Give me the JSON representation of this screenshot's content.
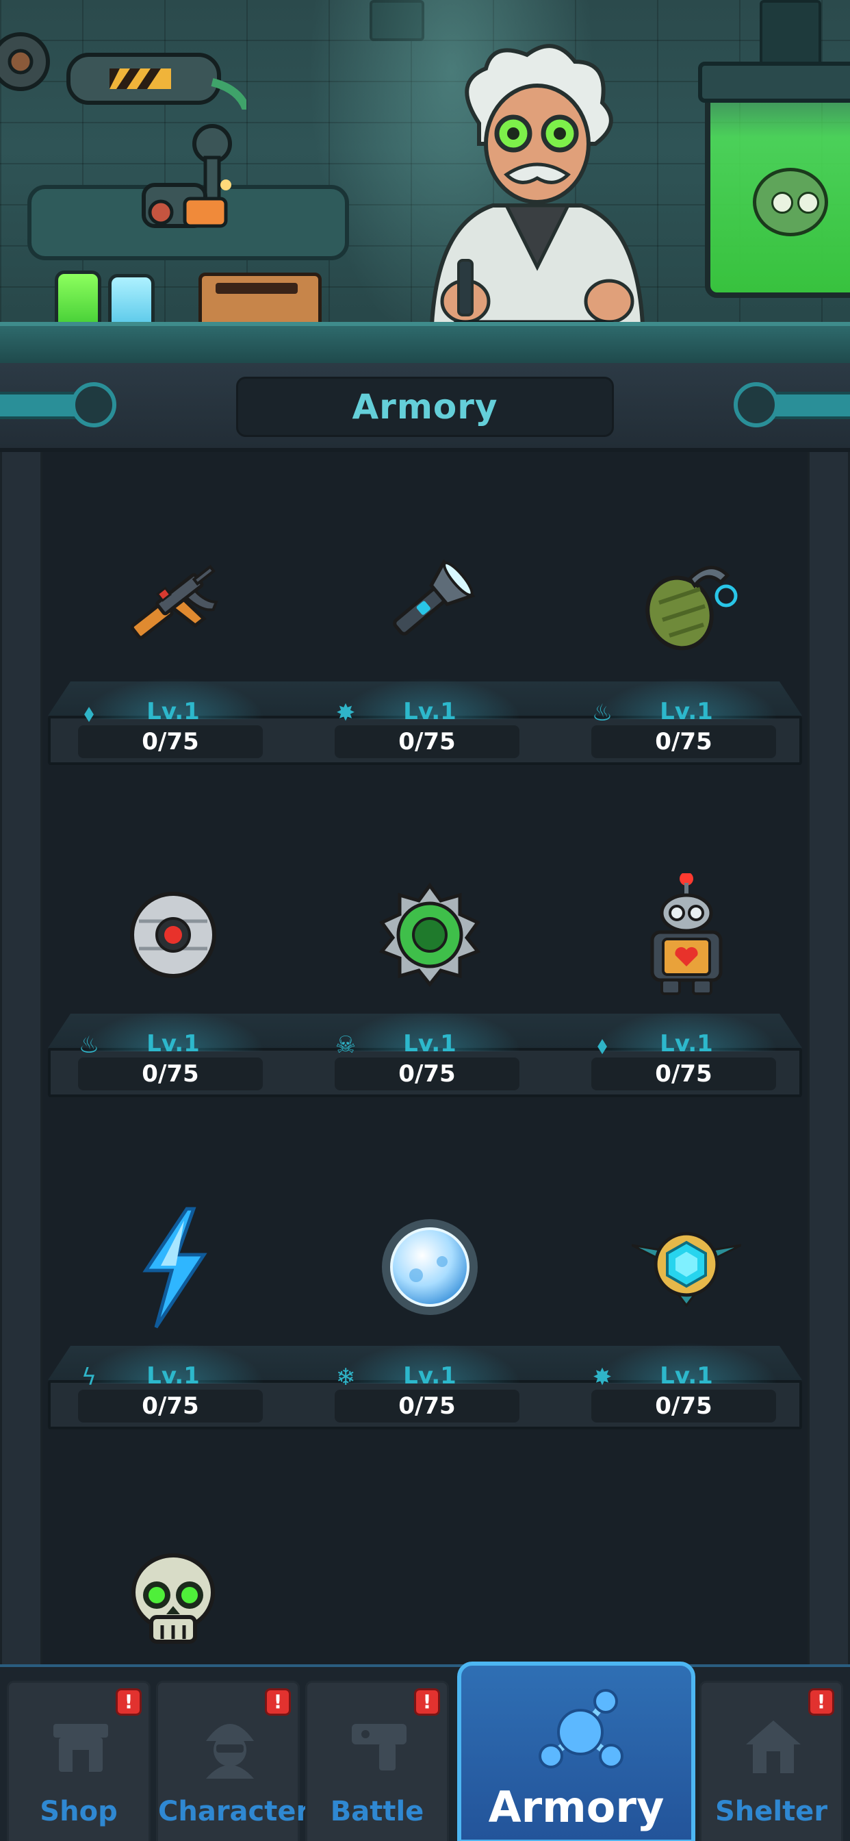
{
  "header": {
    "title": "Armory"
  },
  "armory": {
    "rows": [
      {
        "items": [
          {
            "name": "assault-rifle",
            "stat_icon": "bullet-icon",
            "level": "Lv.1",
            "progress": "0/75"
          },
          {
            "name": "flashlight",
            "stat_icon": "burst-icon",
            "level": "Lv.1",
            "progress": "0/75"
          },
          {
            "name": "grenade",
            "stat_icon": "fire-icon",
            "level": "Lv.1",
            "progress": "0/75"
          }
        ]
      },
      {
        "items": [
          {
            "name": "drone-orb",
            "stat_icon": "fire-icon",
            "level": "Lv.1",
            "progress": "0/75"
          },
          {
            "name": "saw-blade",
            "stat_icon": "skull-icon",
            "level": "Lv.1",
            "progress": "0/75"
          },
          {
            "name": "robot-companion",
            "stat_icon": "bullet-icon",
            "level": "Lv.1",
            "progress": "0/75"
          }
        ]
      },
      {
        "items": [
          {
            "name": "lightning-bolt",
            "stat_icon": "lightning-icon",
            "level": "Lv.1",
            "progress": "0/75"
          },
          {
            "name": "frost-orb",
            "stat_icon": "snowflake-icon",
            "level": "Lv.1",
            "progress": "0/75"
          },
          {
            "name": "gem-shield",
            "stat_icon": "burst-icon",
            "level": "Lv.1",
            "progress": "0/75"
          }
        ]
      }
    ],
    "partial_item": {
      "name": "skull-item"
    }
  },
  "nav": {
    "tabs": [
      {
        "label": "Shop",
        "badge": "!",
        "icon": "shop-icon"
      },
      {
        "label": "Character",
        "badge": "!",
        "icon": "soldier-icon"
      },
      {
        "label": "Battle",
        "badge": "!",
        "icon": "gun-icon"
      },
      {
        "label": "Armory",
        "badge": "",
        "icon": "network-icon",
        "active": true
      },
      {
        "label": "Shelter",
        "badge": "!",
        "icon": "house-icon"
      }
    ]
  },
  "colors": {
    "accent": "#2db8cc",
    "nav_active": "#2f6fb4",
    "badge": "#e2322f"
  }
}
